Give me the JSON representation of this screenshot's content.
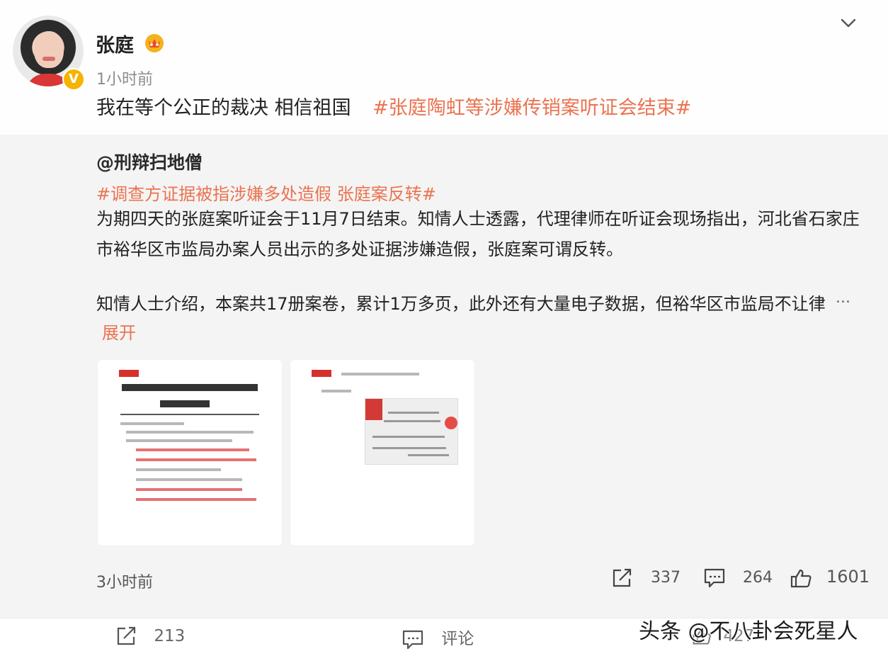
{
  "post": {
    "author": "张庭",
    "time": "1小时前",
    "text": "我在等个公正的裁决 相信祖国",
    "hashtag": "#张庭陶虹等涉嫌传销案听证会结束#"
  },
  "repost": {
    "author": "@刑辩扫地僧",
    "hashtag": "#调查方证据被指涉嫌多处造假 张庭案反转#",
    "paragraph1": "为期四天的张庭案听证会于11月7日结束。知情人士透露，代理律师在听证会现场指出，河北省石家庄市裕华区市监局办案人员出示的多处证据涉嫌造假，张庭案可谓反转。",
    "paragraph2": "知情人士介绍，本案共17册案卷，累计1万多页，此外还有大量电子数据，但裕华区市监局不让律",
    "ellipsis": "...",
    "expand": "展开",
    "time": "3小时前",
    "shares": "337",
    "comments": "264",
    "likes": "1601"
  },
  "bottom": {
    "shares": "213",
    "comment_label": "评论",
    "likes": "427"
  },
  "watermark": "头条 @不八卦会死星人",
  "icons": [
    "crown-icon",
    "verified-icon",
    "chevron-down-icon",
    "share-icon",
    "comment-icon",
    "like-icon"
  ],
  "colors": {
    "hashtag": "#eb7350",
    "verified": "#f4b400"
  }
}
